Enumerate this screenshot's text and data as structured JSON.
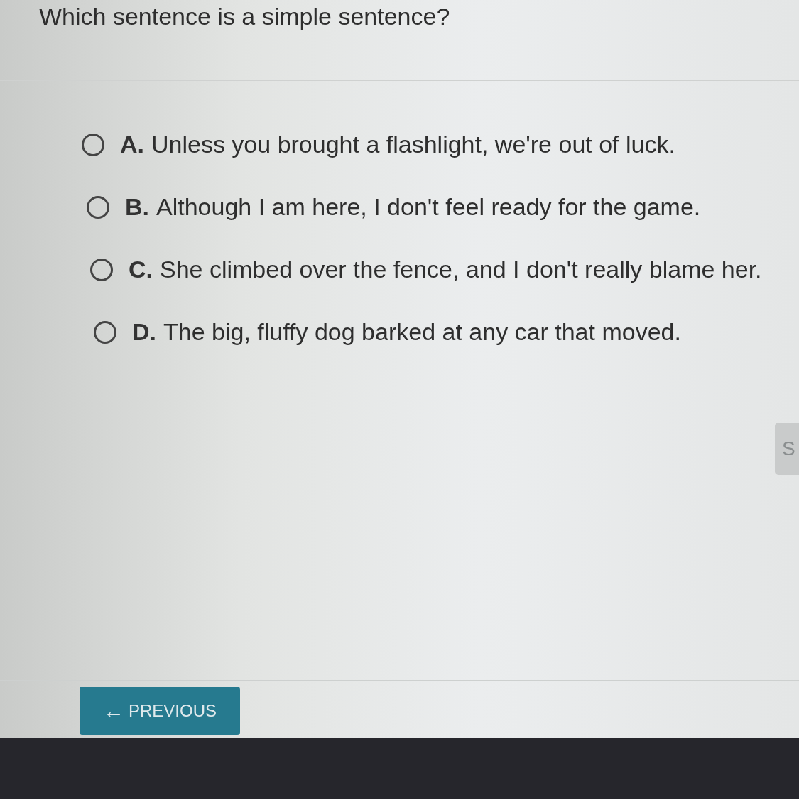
{
  "question": "Which sentence is a simple sentence?",
  "options": [
    {
      "letter": "A.",
      "text": "Unless you brought a flashlight, we're out of luck.",
      "selected": false
    },
    {
      "letter": "B.",
      "text": "Although I am here, I don't feel ready for the game.",
      "selected": false
    },
    {
      "letter": "C.",
      "text": "She climbed over the fence, and I don't really blame her.",
      "selected": false
    },
    {
      "letter": "D.",
      "text": "The big, fluffy dog barked at any car that moved.",
      "selected": false
    }
  ],
  "side_button": {
    "label": "S"
  },
  "previous_button": {
    "icon": "←",
    "label": "PREVIOUS"
  }
}
